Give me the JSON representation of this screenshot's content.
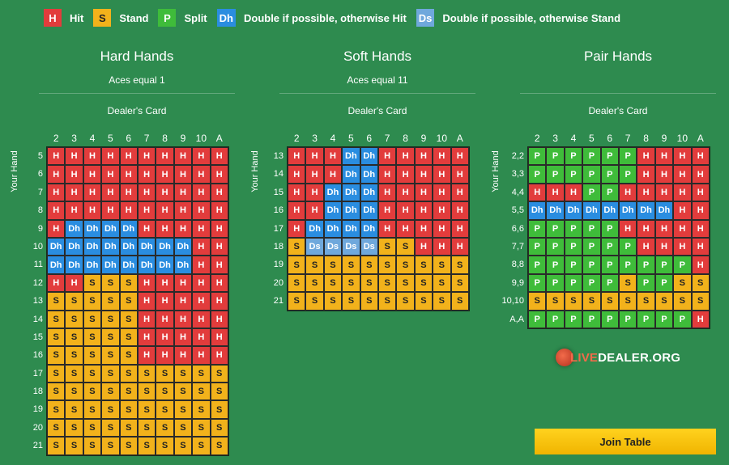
{
  "legend": [
    {
      "code": "H",
      "label": "Hit",
      "color": "#e23c3c"
    },
    {
      "code": "S",
      "label": "Stand",
      "color": "#f2b21b"
    },
    {
      "code": "P",
      "label": "Split",
      "color": "#3fbc3a"
    },
    {
      "code": "Dh",
      "label": "Double if possible, otherwise Hit",
      "color": "#2a8de0"
    },
    {
      "code": "Ds",
      "label": "Double if possible, otherwise Stand",
      "color": "#6fa8dc"
    }
  ],
  "dealer_cards": [
    "2",
    "3",
    "4",
    "5",
    "6",
    "7",
    "8",
    "9",
    "10",
    "A"
  ],
  "your_hand_label": "Your Hand",
  "dealer_label": "Dealer's Card",
  "hard": {
    "title": "Hard Hands",
    "subtitle": "Aces equal 1",
    "rows": [
      "5",
      "6",
      "7",
      "8",
      "9",
      "10",
      "11",
      "12",
      "13",
      "14",
      "15",
      "16",
      "17",
      "18",
      "19",
      "20",
      "21"
    ],
    "cells": [
      [
        "H",
        "H",
        "H",
        "H",
        "H",
        "H",
        "H",
        "H",
        "H",
        "H"
      ],
      [
        "H",
        "H",
        "H",
        "H",
        "H",
        "H",
        "H",
        "H",
        "H",
        "H"
      ],
      [
        "H",
        "H",
        "H",
        "H",
        "H",
        "H",
        "H",
        "H",
        "H",
        "H"
      ],
      [
        "H",
        "H",
        "H",
        "H",
        "H",
        "H",
        "H",
        "H",
        "H",
        "H"
      ],
      [
        "H",
        "Dh",
        "Dh",
        "Dh",
        "Dh",
        "H",
        "H",
        "H",
        "H",
        "H"
      ],
      [
        "Dh",
        "Dh",
        "Dh",
        "Dh",
        "Dh",
        "Dh",
        "Dh",
        "Dh",
        "H",
        "H"
      ],
      [
        "Dh",
        "Dh",
        "Dh",
        "Dh",
        "Dh",
        "Dh",
        "Dh",
        "Dh",
        "H",
        "H"
      ],
      [
        "H",
        "H",
        "S",
        "S",
        "S",
        "H",
        "H",
        "H",
        "H",
        "H"
      ],
      [
        "S",
        "S",
        "S",
        "S",
        "S",
        "H",
        "H",
        "H",
        "H",
        "H"
      ],
      [
        "S",
        "S",
        "S",
        "S",
        "S",
        "H",
        "H",
        "H",
        "H",
        "H"
      ],
      [
        "S",
        "S",
        "S",
        "S",
        "S",
        "H",
        "H",
        "H",
        "H",
        "H"
      ],
      [
        "S",
        "S",
        "S",
        "S",
        "S",
        "H",
        "H",
        "H",
        "H",
        "H"
      ],
      [
        "S",
        "S",
        "S",
        "S",
        "S",
        "S",
        "S",
        "S",
        "S",
        "S"
      ],
      [
        "S",
        "S",
        "S",
        "S",
        "S",
        "S",
        "S",
        "S",
        "S",
        "S"
      ],
      [
        "S",
        "S",
        "S",
        "S",
        "S",
        "S",
        "S",
        "S",
        "S",
        "S"
      ],
      [
        "S",
        "S",
        "S",
        "S",
        "S",
        "S",
        "S",
        "S",
        "S",
        "S"
      ],
      [
        "S",
        "S",
        "S",
        "S",
        "S",
        "S",
        "S",
        "S",
        "S",
        "S"
      ]
    ]
  },
  "soft": {
    "title": "Soft Hands",
    "subtitle": "Aces equal 11",
    "rows": [
      "13",
      "14",
      "15",
      "16",
      "17",
      "18",
      "19",
      "20",
      "21"
    ],
    "cells": [
      [
        "H",
        "H",
        "H",
        "Dh",
        "Dh",
        "H",
        "H",
        "H",
        "H",
        "H"
      ],
      [
        "H",
        "H",
        "H",
        "Dh",
        "Dh",
        "H",
        "H",
        "H",
        "H",
        "H"
      ],
      [
        "H",
        "H",
        "Dh",
        "Dh",
        "Dh",
        "H",
        "H",
        "H",
        "H",
        "H"
      ],
      [
        "H",
        "H",
        "Dh",
        "Dh",
        "Dh",
        "H",
        "H",
        "H",
        "H",
        "H"
      ],
      [
        "H",
        "Dh",
        "Dh",
        "Dh",
        "Dh",
        "H",
        "H",
        "H",
        "H",
        "H"
      ],
      [
        "S",
        "Ds",
        "Ds",
        "Ds",
        "Ds",
        "S",
        "S",
        "H",
        "H",
        "H"
      ],
      [
        "S",
        "S",
        "S",
        "S",
        "S",
        "S",
        "S",
        "S",
        "S",
        "S"
      ],
      [
        "S",
        "S",
        "S",
        "S",
        "S",
        "S",
        "S",
        "S",
        "S",
        "S"
      ],
      [
        "S",
        "S",
        "S",
        "S",
        "S",
        "S",
        "S",
        "S",
        "S",
        "S"
      ]
    ]
  },
  "pair": {
    "title": "Pair Hands",
    "rows": [
      "2,2",
      "3,3",
      "4,4",
      "5,5",
      "6,6",
      "7,7",
      "8,8",
      "9,9",
      "10,10",
      "A,A"
    ],
    "cells": [
      [
        "P",
        "P",
        "P",
        "P",
        "P",
        "P",
        "H",
        "H",
        "H",
        "H"
      ],
      [
        "P",
        "P",
        "P",
        "P",
        "P",
        "P",
        "H",
        "H",
        "H",
        "H"
      ],
      [
        "H",
        "H",
        "H",
        "P",
        "P",
        "H",
        "H",
        "H",
        "H",
        "H"
      ],
      [
        "Dh",
        "Dh",
        "Dh",
        "Dh",
        "Dh",
        "Dh",
        "Dh",
        "Dh",
        "H",
        "H"
      ],
      [
        "P",
        "P",
        "P",
        "P",
        "P",
        "H",
        "H",
        "H",
        "H",
        "H"
      ],
      [
        "P",
        "P",
        "P",
        "P",
        "P",
        "P",
        "H",
        "H",
        "H",
        "H"
      ],
      [
        "P",
        "P",
        "P",
        "P",
        "P",
        "P",
        "P",
        "P",
        "P",
        "H"
      ],
      [
        "P",
        "P",
        "P",
        "P",
        "P",
        "S",
        "P",
        "P",
        "S",
        "S"
      ],
      [
        "S",
        "S",
        "S",
        "S",
        "S",
        "S",
        "S",
        "S",
        "S",
        "S"
      ],
      [
        "P",
        "P",
        "P",
        "P",
        "P",
        "P",
        "P",
        "P",
        "P",
        "H"
      ]
    ]
  },
  "logo": {
    "prefix": "LIVE",
    "suffix": "DEALER.ORG"
  },
  "join_button": "Join Table"
}
